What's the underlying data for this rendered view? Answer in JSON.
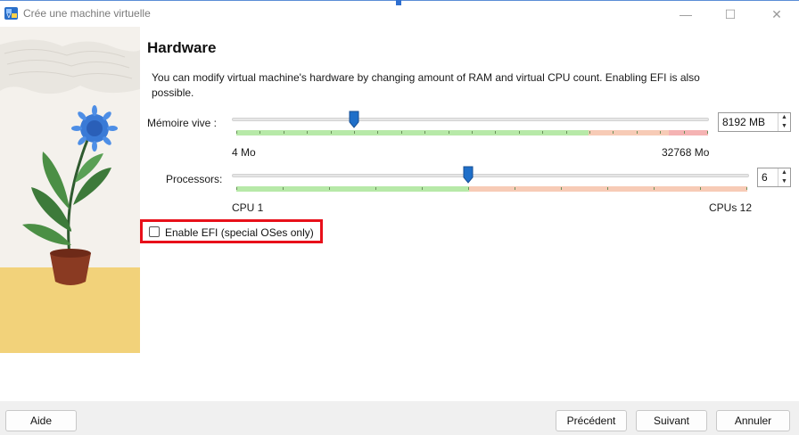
{
  "window": {
    "title": "Crée une machine virtuelle",
    "min_glyph": "—",
    "max_glyph": "☐",
    "close_glyph": "✕"
  },
  "page": {
    "heading": "Hardware",
    "description": "You can modify virtual machine's hardware by changing amount of RAM and virtual CPU count. Enabling EFI is also possible."
  },
  "memory": {
    "label": "Mémoire vive :",
    "min_label": "4 Mo",
    "max_label": "32768 Mo",
    "value_text": "8192 MB",
    "value": 8192,
    "min": 4,
    "max": 32768
  },
  "processors": {
    "label": "Processors:",
    "min_label": "CPU 1",
    "max_label": "CPUs 12",
    "value_text": "6",
    "value": 6,
    "min": 1,
    "max": 12
  },
  "efi": {
    "label": "Enable EFI (special OSes only)",
    "checked": false
  },
  "buttons": {
    "help": "Aide",
    "back": "Précédent",
    "next": "Suivant",
    "cancel": "Annuler"
  },
  "colors": {
    "accent": "#1f6fc9",
    "safe_zone": "#b7e9a8",
    "warn_zone": "#f7cbb6",
    "danger_zone": "#f5b3b3",
    "highlight": "#e8101a"
  }
}
